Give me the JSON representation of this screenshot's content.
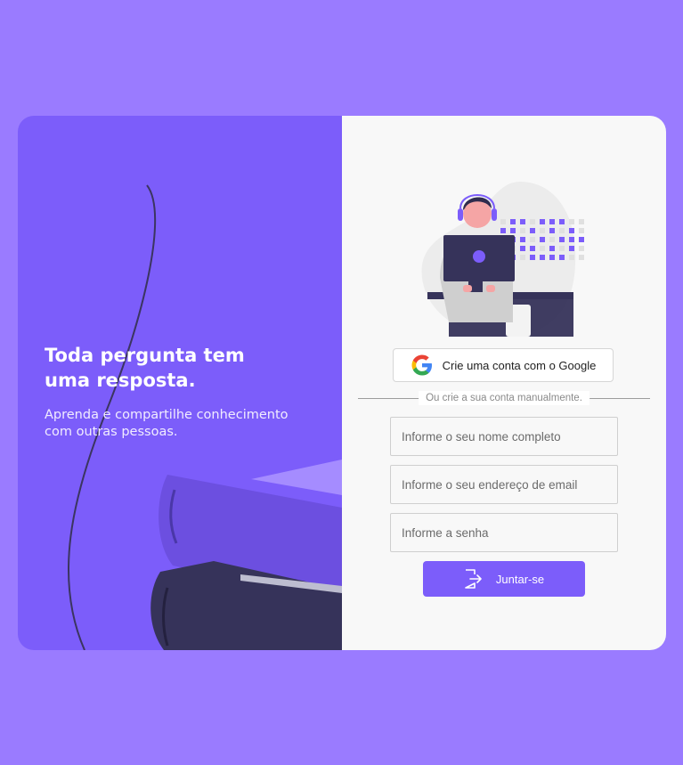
{
  "hero": {
    "headline": "Toda pergunta tem uma resposta.",
    "subtext": "Aprenda e compartilhe conhecimento com outras pessoas."
  },
  "google_button": {
    "label": "Crie uma conta com o Google",
    "icon": "google-icon"
  },
  "divider": {
    "text": "Ou crie a sua conta manualmente."
  },
  "form": {
    "name_placeholder": "Informe o seu nome completo",
    "email_placeholder": "Informe o seu endereço de email",
    "password_placeholder": "Informe a senha",
    "name_value": "",
    "email_value": "",
    "password_value": ""
  },
  "submit": {
    "label": "Juntar-se",
    "icon": "sign-in-icon"
  },
  "colors": {
    "page_background": "#9a7bff",
    "accent": "#7c5dfa",
    "book_dark": "#36335a",
    "panel_light": "#f8f8f8"
  }
}
